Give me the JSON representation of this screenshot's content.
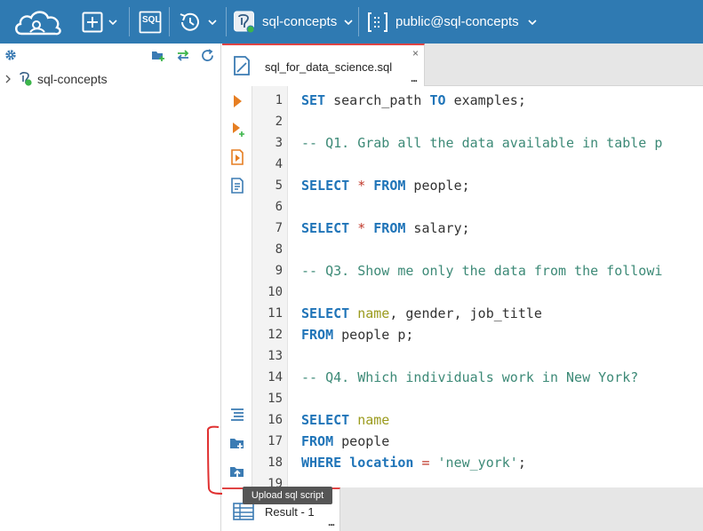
{
  "toolbar": {
    "connection_name": "sql-concepts",
    "schema_name": "public@sql-concepts",
    "sql_button_label": "SQL"
  },
  "navigator": {
    "tree": [
      {
        "label": "sql-concepts"
      }
    ]
  },
  "editor": {
    "tab_label": "sql_for_data_science.sql",
    "tab_close": "×",
    "tab_more": "...",
    "line_numbers": [
      "1",
      "2",
      "3",
      "4",
      "5",
      "6",
      "7",
      "8",
      "9",
      "10",
      "11",
      "12",
      "13",
      "14",
      "15",
      "16",
      "17",
      "18",
      "19"
    ],
    "code": {
      "l1": [
        "SET",
        " search_path ",
        "TO",
        " examples;"
      ],
      "l3": "-- Q1. Grab all the data available in table p",
      "l5": [
        "SELECT",
        " ",
        "*",
        " ",
        "FROM",
        " people;"
      ],
      "l7": [
        "SELECT",
        " ",
        "*",
        " ",
        "FROM",
        " salary;"
      ],
      "l9": "-- Q3. Show me only the data from the followi",
      "l11": [
        "SELECT",
        " ",
        "name",
        ", gender, job_title"
      ],
      "l12": [
        "FROM",
        " people p;"
      ],
      "l14": "-- Q4. Which individuals work in New York?",
      "l16": [
        "SELECT",
        " ",
        "name"
      ],
      "l17": [
        "FROM",
        " people"
      ],
      "l18": [
        "WHERE",
        " ",
        "location",
        " ",
        "=",
        " ",
        "'new_york'",
        ";"
      ]
    }
  },
  "tooltip": {
    "text": "Upload sql script"
  },
  "results": {
    "tab_label": "Result - 1",
    "tab_more": "..."
  },
  "colors": {
    "toolbar_bg": "#2f7ab2",
    "keyword": "#1f74b8",
    "comment": "#3d8a77",
    "column": "#9b9b1e",
    "accent_red": "#e04444",
    "tool_orange": "#e67e22"
  }
}
